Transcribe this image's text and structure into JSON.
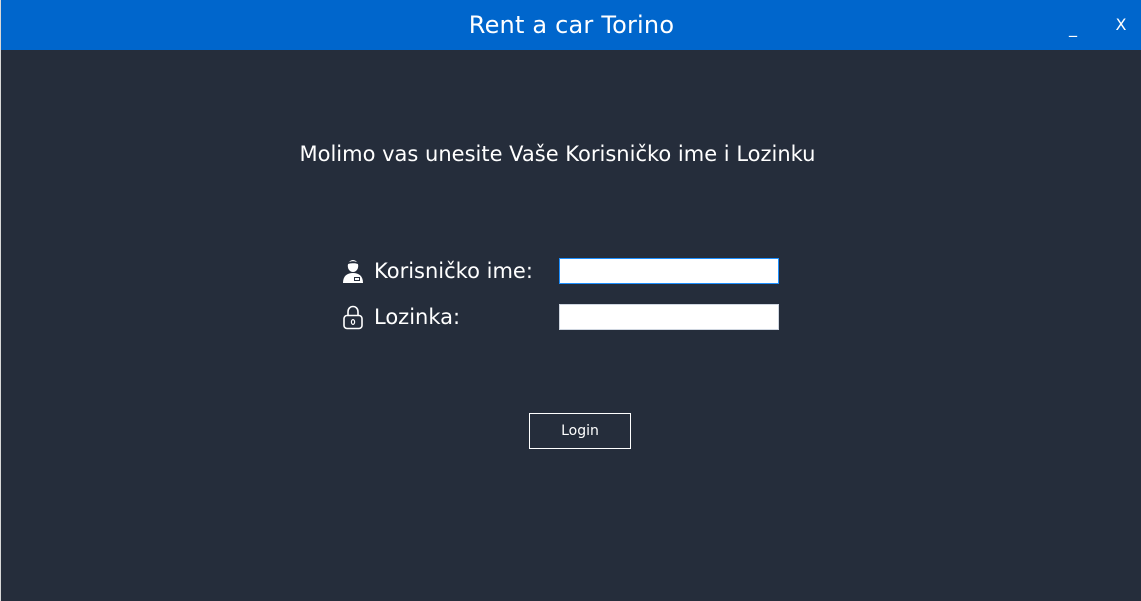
{
  "window": {
    "title": "Rent a car Torino",
    "minimize_label": "_",
    "close_label": "X"
  },
  "login_form": {
    "prompt": "Molimo vas unesite Vaše Korisničko ime i Lozinku",
    "username": {
      "label": "Korisničko ime:",
      "icon": "user-icon",
      "value": "",
      "placeholder": ""
    },
    "password": {
      "label": "Lozinka:",
      "icon": "lock-icon",
      "value": "",
      "placeholder": ""
    },
    "login_label": "Login"
  },
  "colors": {
    "titlebar": "#0066cc",
    "background": "#252d3b",
    "text": "#ffffff"
  }
}
